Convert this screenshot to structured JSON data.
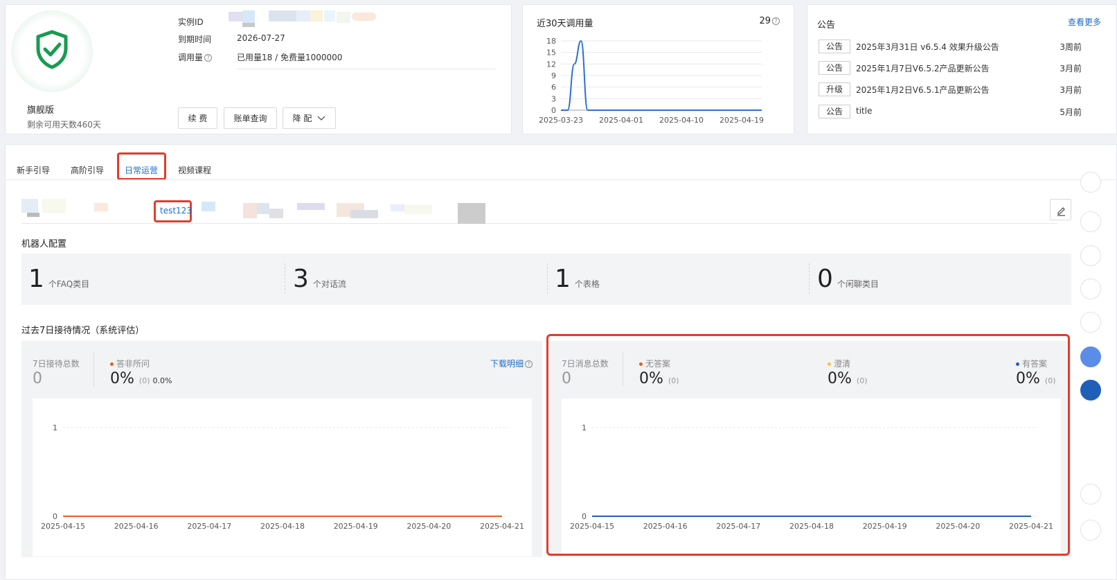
{
  "plan": {
    "name": "旗舰版",
    "remaining": "剩余可用天数460天",
    "instance_label": "实例ID",
    "expire_label": "到期时间",
    "expire_value": "2026-07-27",
    "usage_label": "调用量",
    "usage_value": "已用量18 / 免费量1000000",
    "buttons": {
      "renew": "续 费",
      "bill": "账单查询",
      "downgrade": "降 配"
    },
    "shield_color": "#1a9b52"
  },
  "calls": {
    "title": "近30天调用量",
    "total": "29"
  },
  "chart_data": [
    {
      "type": "line",
      "title": "近30天调用量",
      "x": [
        "2025-03-23",
        "2025-04-01",
        "2025-04-10",
        "2025-04-19"
      ],
      "x_ticks": [
        "2025-03-23",
        "2025-04-01",
        "2025-04-10",
        "2025-04-19"
      ],
      "ylim": [
        0,
        18
      ],
      "y_ticks": [
        "0",
        "3",
        "6",
        "9",
        "12",
        "15",
        "18"
      ],
      "series": [
        {
          "name": "",
          "color": "#2b6fd6",
          "points": [
            [
              "2025-03-23",
              0
            ],
            [
              "2025-03-24",
              0
            ],
            [
              "2025-03-25",
              12
            ],
            [
              "2025-03-26",
              18
            ],
            [
              "2025-03-27",
              0
            ],
            [
              "2025-03-28",
              0
            ],
            [
              "2025-04-22",
              0
            ]
          ]
        }
      ],
      "grid": true
    },
    {
      "type": "line",
      "title": "",
      "x": [
        "2025-04-15",
        "2025-04-16",
        "2025-04-17",
        "2025-04-18",
        "2025-04-19",
        "2025-04-20",
        "2025-04-21"
      ],
      "ylim": [
        0,
        1
      ],
      "y_ticks": [
        "0",
        "1"
      ],
      "series": [
        {
          "name": "答非所问",
          "color": "#f05a1e",
          "values": [
            0,
            0,
            0,
            0,
            0,
            0,
            0
          ]
        }
      ],
      "grid": true
    },
    {
      "type": "line",
      "title": "",
      "x": [
        "2025-04-15",
        "2025-04-16",
        "2025-04-17",
        "2025-04-18",
        "2025-04-19",
        "2025-04-20",
        "2025-04-21"
      ],
      "ylim": [
        0,
        1
      ],
      "y_ticks": [
        "0",
        "1"
      ],
      "series": [
        {
          "name": "有答案",
          "color": "#1f5fb8",
          "values": [
            0,
            0,
            0,
            0,
            0,
            0,
            0
          ]
        }
      ],
      "grid": true
    }
  ],
  "notice": {
    "title": "公告",
    "more": "查看更多",
    "items": [
      {
        "tag": "公告",
        "text": "2025年3月31日 v6.5.4 效果升级公告",
        "time": "3周前"
      },
      {
        "tag": "公告",
        "text": "2025年1月7日V6.5.2产品更新公告",
        "time": "3月前"
      },
      {
        "tag": "升级",
        "text": "2025年1月2日V6.5.1产品更新公告",
        "time": "3月前"
      },
      {
        "tag": "公告",
        "text": "title",
        "time": "5月前"
      }
    ]
  },
  "tabs": [
    "新手引导",
    "高阶引导",
    "日常运营",
    "视频课程"
  ],
  "active_tab": "日常运营",
  "bot": {
    "active": "test123"
  },
  "robot_config": {
    "title": "机器人配置",
    "stats": [
      {
        "num": "1",
        "label": "个FAQ类目"
      },
      {
        "num": "3",
        "label": "个对话流"
      },
      {
        "num": "1",
        "label": "个表格"
      },
      {
        "num": "0",
        "label": "个闲聊类目"
      }
    ]
  },
  "reception": {
    "title": "过去7日接待情况（系统评估）",
    "left": {
      "total_label": "7日接待总数",
      "total_value": "0",
      "wrong_label": "答非所问",
      "wrong_value": "0%",
      "wrong_count": "(0)",
      "wrong_extra": "0.0%",
      "download": "下载明细"
    },
    "right": {
      "total_label": "7日消息总数",
      "total_value": "0",
      "items": [
        {
          "label": "无答案",
          "value": "0%",
          "count": "(0)",
          "color": "#f05a1e"
        },
        {
          "label": "澄清",
          "value": "0%",
          "count": "(0)",
          "color": "#f5c242"
        },
        {
          "label": "有答案",
          "value": "0%",
          "count": "(0)",
          "color": "#1f5fb8"
        }
      ]
    }
  },
  "colors": {
    "accent": "#1a6dcc",
    "highlight": "#e03c2e"
  }
}
